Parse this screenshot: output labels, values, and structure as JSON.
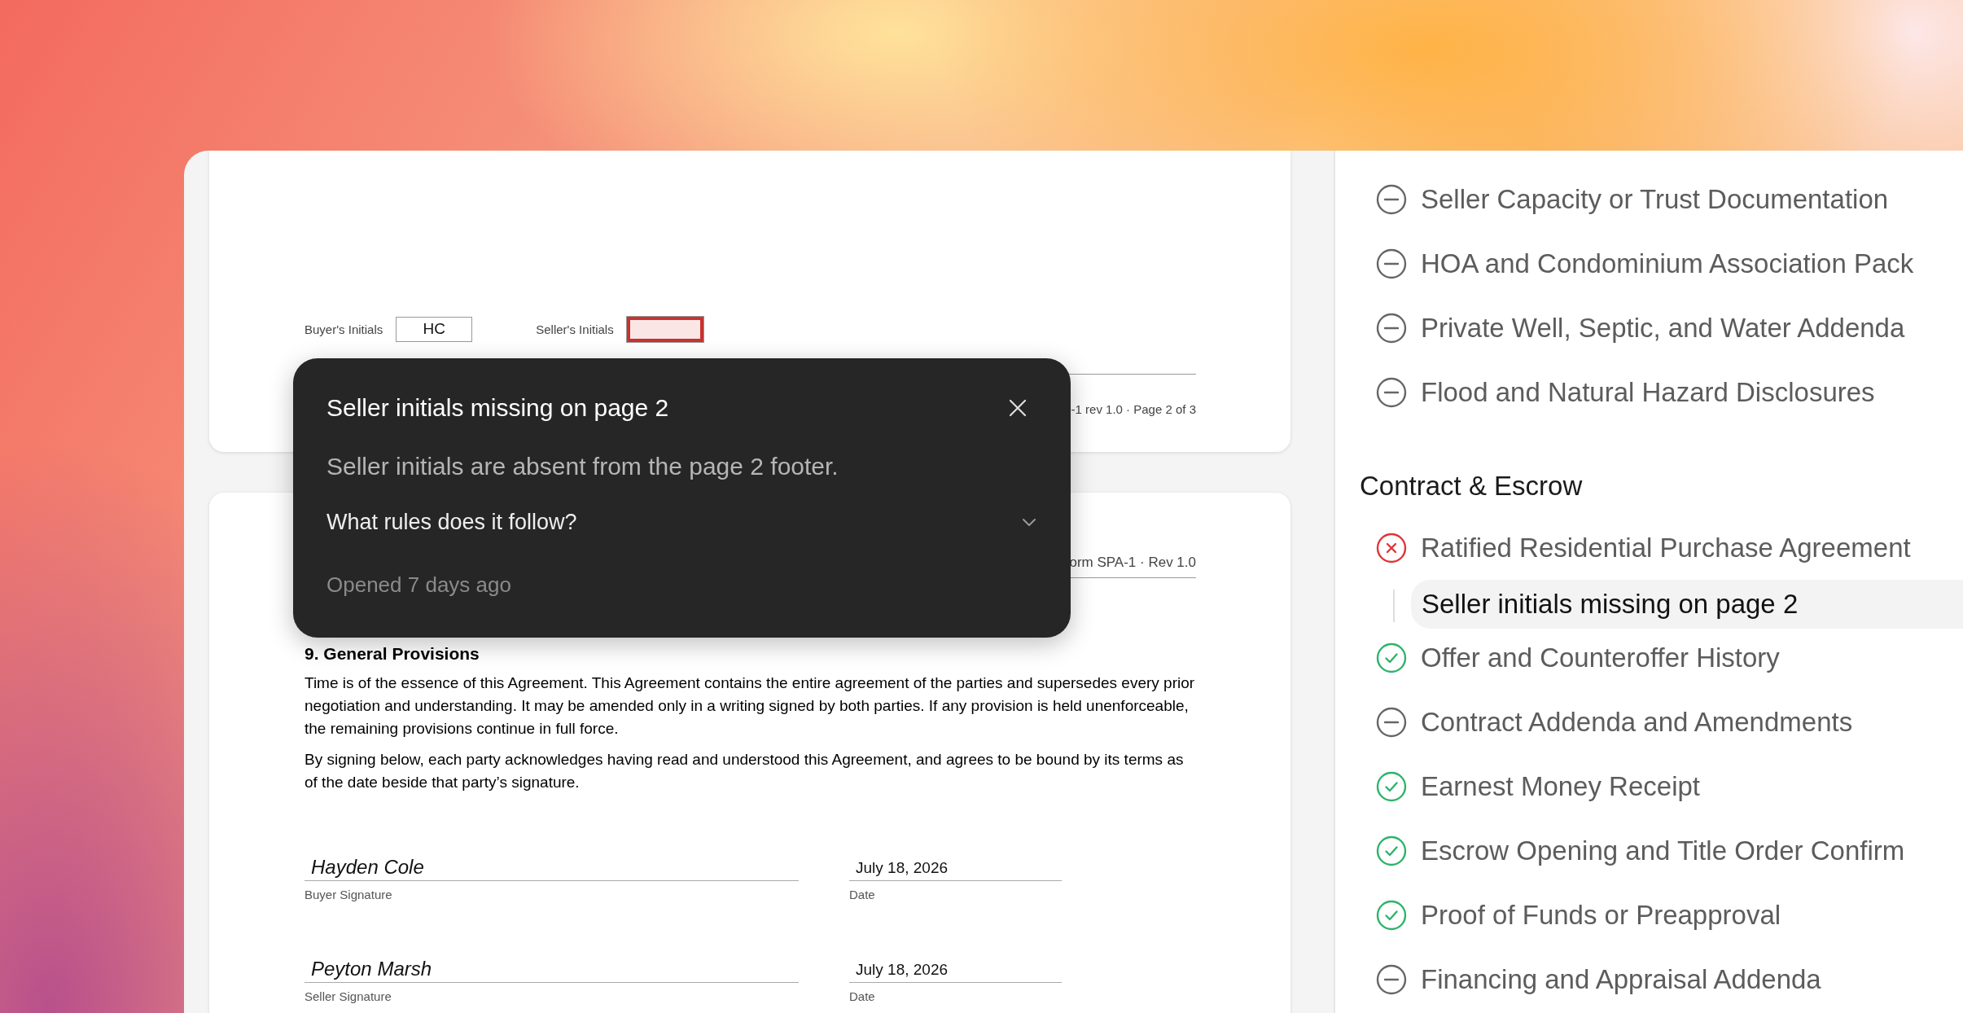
{
  "document": {
    "page_1": {
      "initials": [
        {
          "label": "Buyer's Initials",
          "value": "HC",
          "missing": false
        },
        {
          "label": "Seller's Initials",
          "missing": true
        }
      ],
      "footer": "-1 rev 1.0 · Page 2 of 3"
    },
    "page_2": {
      "header": "orm SPA-1 · Rev 1.0",
      "heading": "9. General Provisions",
      "paragraphs": [
        "Time is of the essence of this Agreement. This Agreement contains the entire agreement of the parties and supersedes every prior negotiation and understanding. It may be amended only in a writing signed by both parties. If any provision is held unenforceable, the remaining provisions continue in full force.",
        "By signing below, each party acknowledges having read and understood this Agreement, and agrees to be bound by its terms as of the date beside that party’s signature."
      ],
      "signatures": [
        {
          "name": "Hayden Cole",
          "label": "Buyer Signature",
          "date": "July 18, 2026",
          "date_label": "Date"
        },
        {
          "name": "Peyton Marsh",
          "label": "Seller Signature",
          "date": "July 18, 2026",
          "date_label": "Date"
        }
      ]
    }
  },
  "popover": {
    "title": "Seller initials missing on page 2",
    "description": "Seller initials are absent from the page 2 footer.",
    "question": "What rules does it follow?",
    "expanded": false,
    "opened": "Opened 7 days ago"
  },
  "sidebar": {
    "groups": [
      {
        "items": [
          {
            "label": "Seller Capacity or Trust Documentation",
            "kind": "not_applicable"
          },
          {
            "label": "HOA and Condominium Association Pack",
            "kind": "not_applicable"
          },
          {
            "label": "Private Well, Septic, and Water Addenda",
            "kind": "not_applicable"
          },
          {
            "label": "Flood and Natural Hazard Disclosures",
            "kind": "not_applicable"
          }
        ]
      },
      {
        "heading": "Contract & Escrow",
        "items": [
          {
            "label": "Ratified Residential Purchase Agreement",
            "kind": "error",
            "children": [
              {
                "label": "Seller initials missing on page 2",
                "selected": true
              }
            ]
          },
          {
            "label": "Offer and Counteroffer History",
            "kind": "complete"
          },
          {
            "label": "Contract Addenda and Amendments",
            "kind": "not_applicable"
          },
          {
            "label": "Earnest Money Receipt",
            "kind": "complete"
          },
          {
            "label": "Escrow Opening and Title Order Confirm",
            "kind": "complete"
          },
          {
            "label": "Proof of Funds or Preapproval",
            "kind": "complete"
          },
          {
            "label": "Financing and Appraisal Addenda",
            "kind": "not_applicable"
          }
        ]
      }
    ]
  }
}
